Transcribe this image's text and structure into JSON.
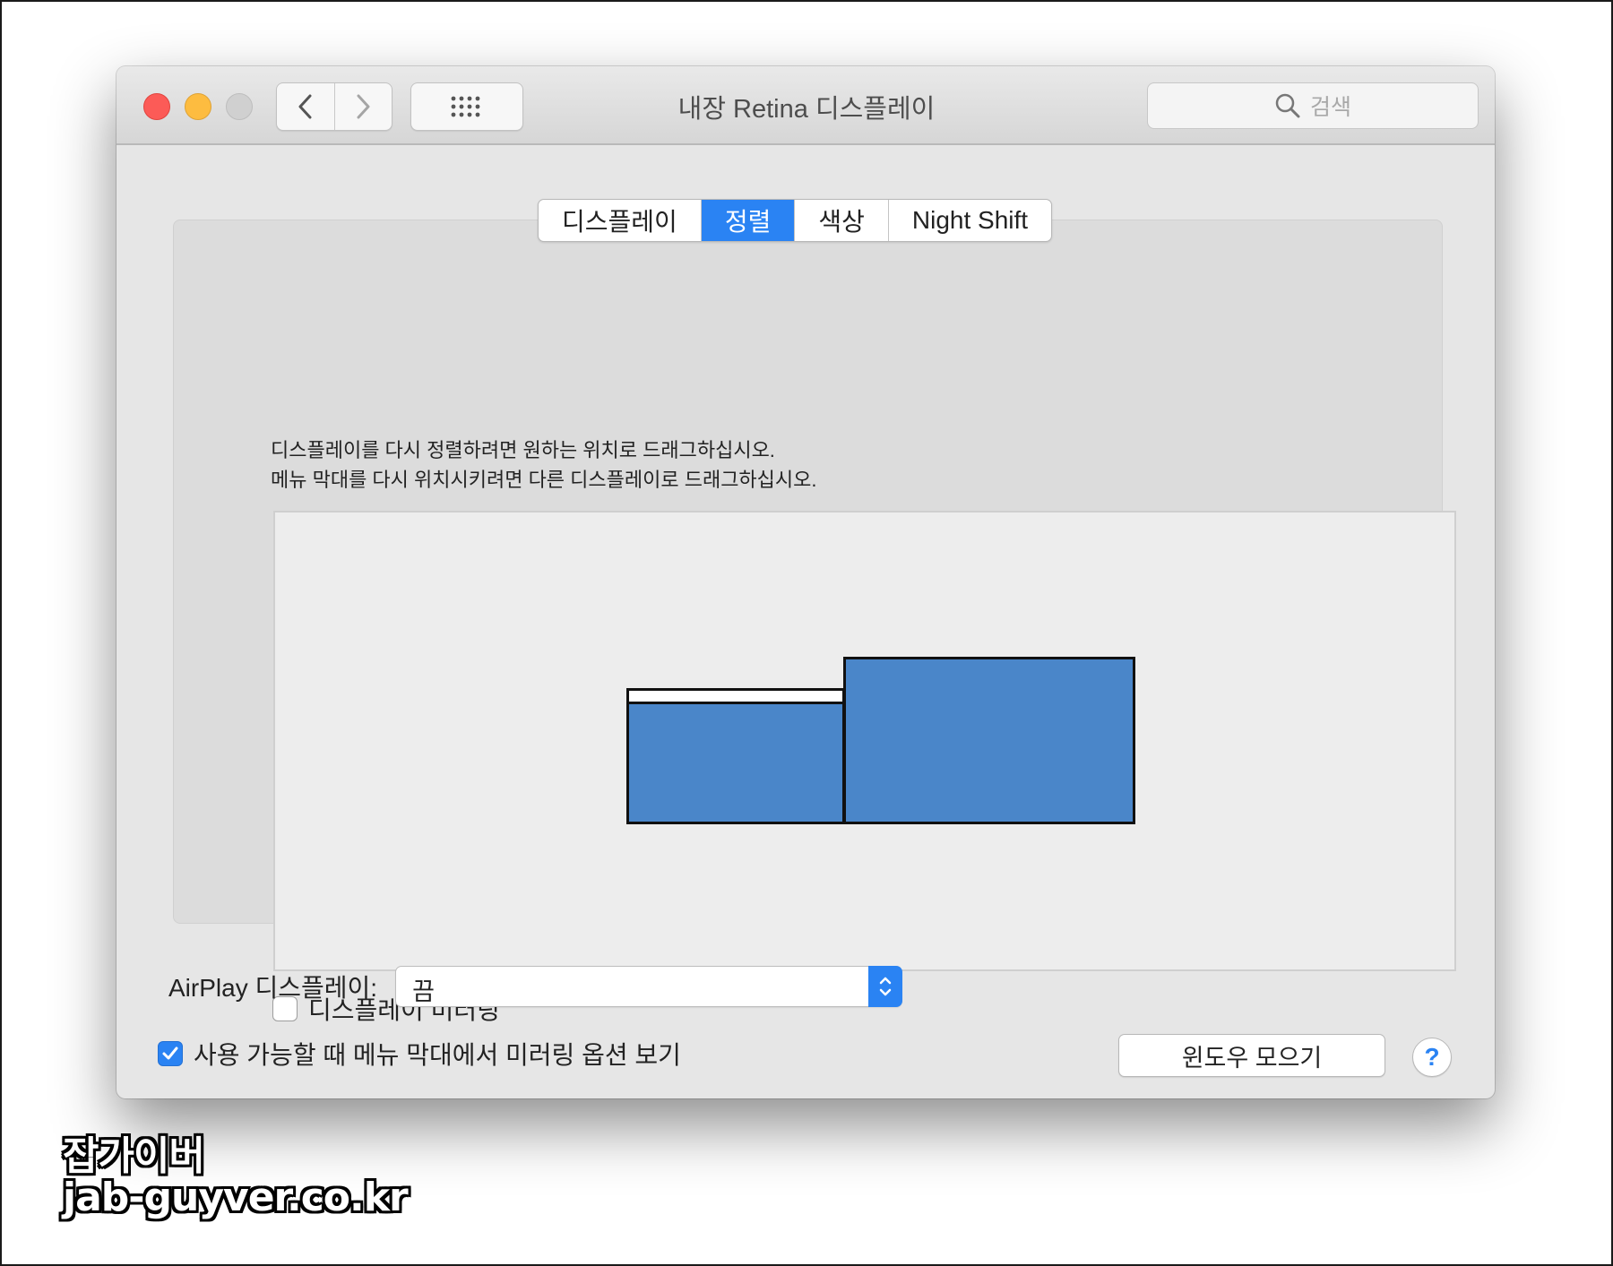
{
  "window": {
    "title": "내장 Retina 디스플레이",
    "search_placeholder": "검색"
  },
  "tabs": [
    {
      "label": "디스플레이",
      "active": false
    },
    {
      "label": "정렬",
      "active": true
    },
    {
      "label": "색상",
      "active": false
    },
    {
      "label": "Night Shift",
      "active": false
    }
  ],
  "arrangement": {
    "instruction_line1": "디스플레이를 다시 정렬하려면 원하는 위치로 드래그하십시오.",
    "instruction_line2": "메뉴 막대를 다시 위치시키려면 다른 디스플레이로 드래그하십시오.",
    "mirroring_label": "디스플레이 미러링",
    "mirroring_checked": false
  },
  "airplay": {
    "label": "AirPlay 디스플레이:",
    "value": "끔"
  },
  "menu_mirroring": {
    "label": "사용 가능할 때 메뉴 막대에서 미러링 옵션 보기",
    "checked": true
  },
  "buttons": {
    "gather_windows": "윈도우 모으기",
    "help": "?"
  },
  "colors": {
    "accent": "#2a83f3",
    "monitor_fill": "#4a86c9",
    "close": "#fc5b57",
    "minimize": "#fdbc40",
    "zoom_disabled": "#d0d0d0"
  },
  "watermark": {
    "name": "잡가이버",
    "url": "jab-guyver.co.kr"
  }
}
